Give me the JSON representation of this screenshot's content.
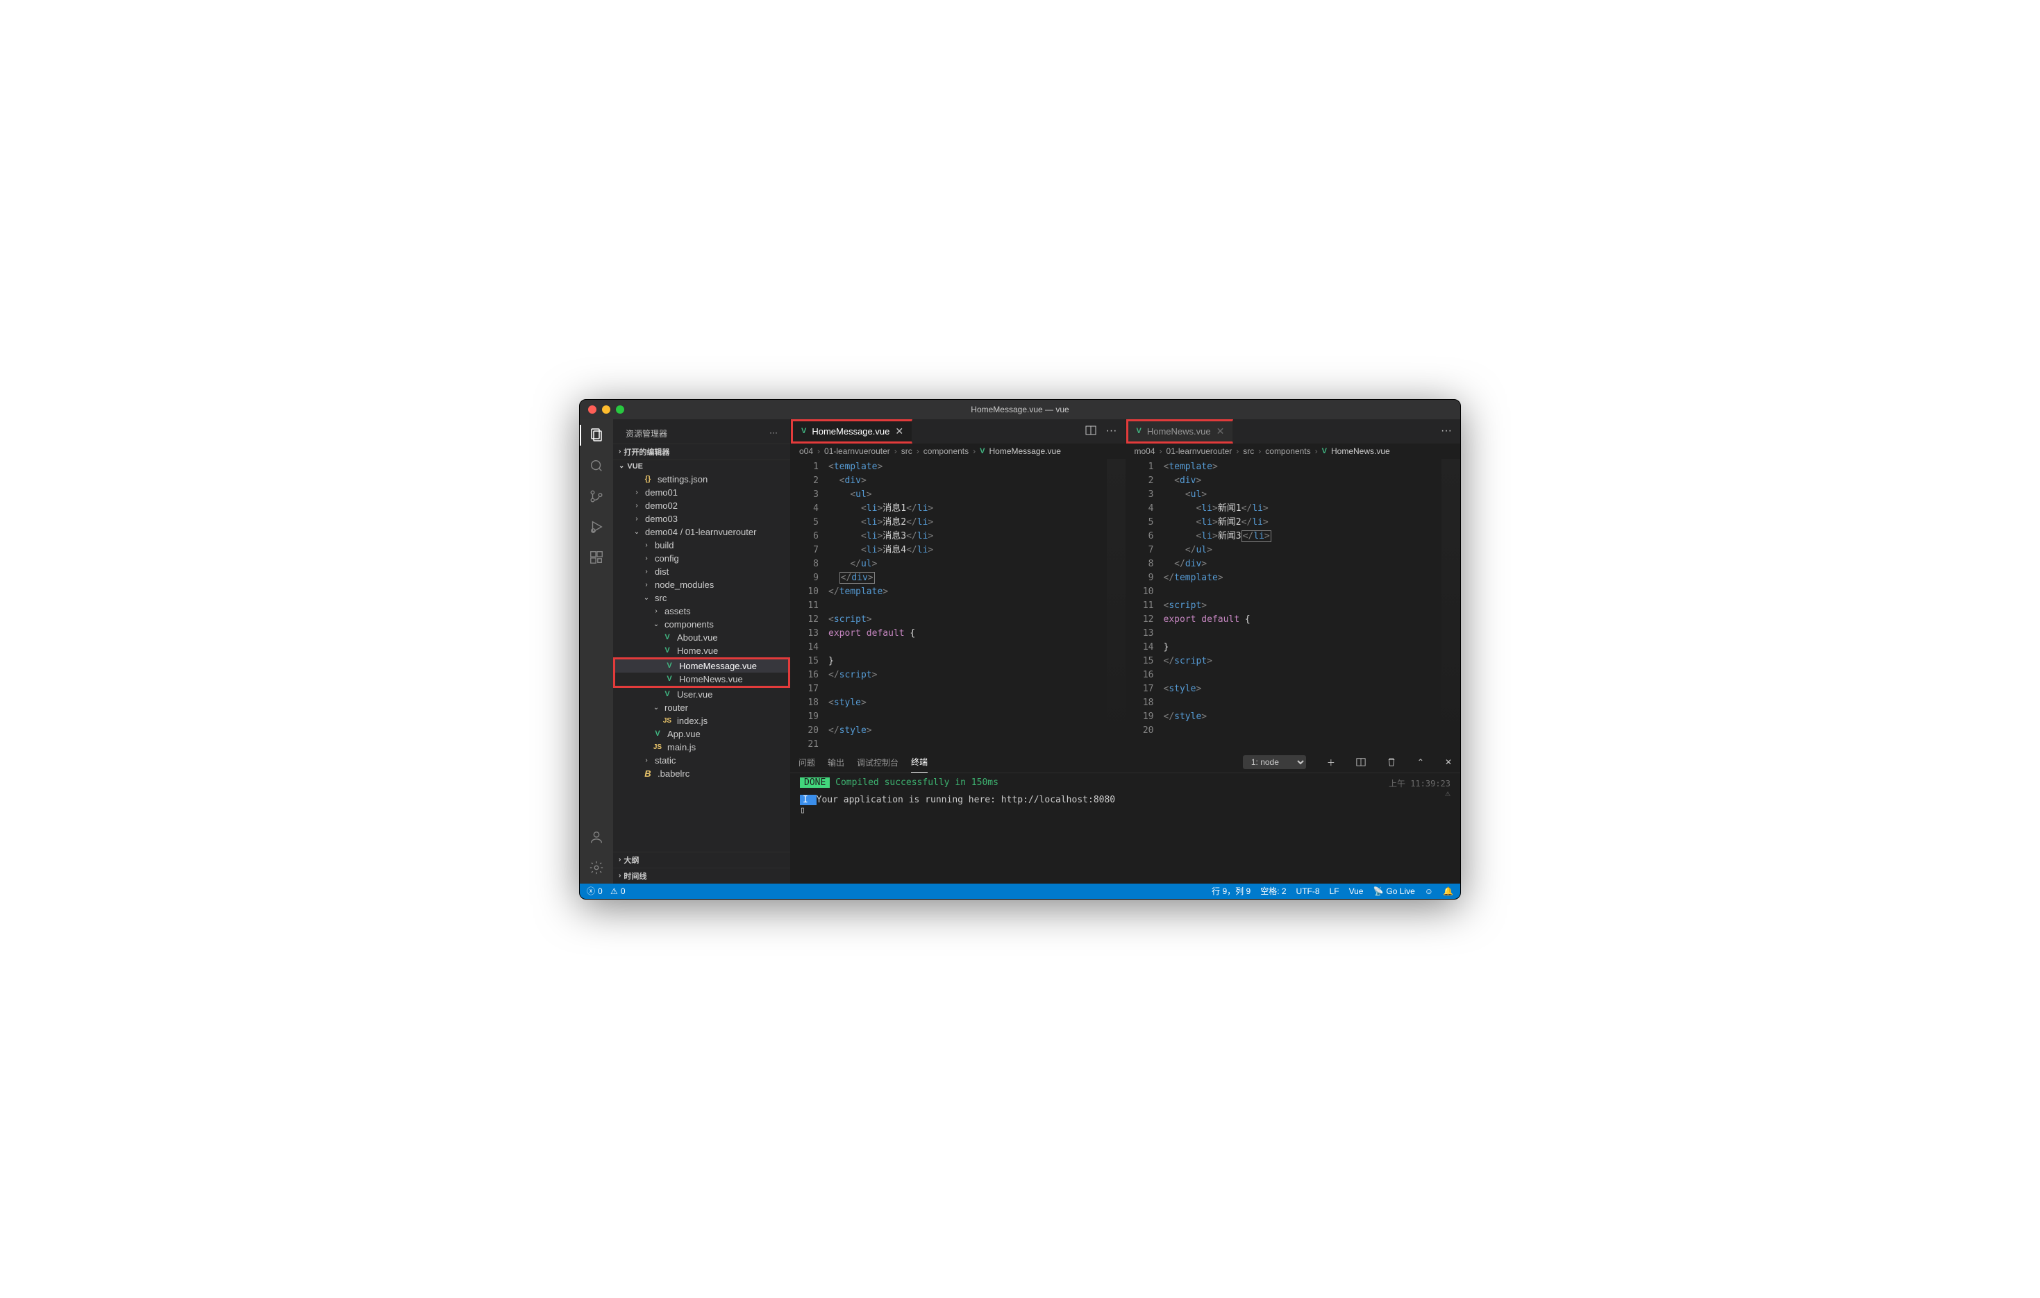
{
  "window_title": "HomeMessage.vue — vue",
  "sidebar": {
    "title": "资源管理器",
    "sections": {
      "open_editors": "打开的编辑器",
      "workspace": "VUE",
      "outline": "大纲",
      "timeline": "时间线"
    },
    "tree": {
      "settings": "settings.json",
      "demo01": "demo01",
      "demo02": "demo02",
      "demo03": "demo03",
      "demo04": "demo04 / 01-learnvuerouter",
      "build": "build",
      "config": "config",
      "dist": "dist",
      "node_modules": "node_modules",
      "src": "src",
      "assets": "assets",
      "components": "components",
      "about": "About.vue",
      "home": "Home.vue",
      "homemsg": "HomeMessage.vue",
      "homenews": "HomeNews.vue",
      "user": "User.vue",
      "router": "router",
      "indexjs": "index.js",
      "appvue": "App.vue",
      "mainjs": "main.js",
      "static": "static",
      "babelrc": ".babelrc"
    }
  },
  "editors": {
    "left": {
      "tab": "HomeMessage.vue",
      "breadcrumb": [
        "o04",
        "01-learnvuerouter",
        "src",
        "components",
        "HomeMessage.vue"
      ],
      "lines": [
        "1",
        "2",
        "3",
        "4",
        "5",
        "6",
        "7",
        "8",
        "9",
        "10",
        "11",
        "12",
        "13",
        "14",
        "15",
        "16",
        "17",
        "18",
        "19",
        "20",
        "21"
      ],
      "code": {
        "l1": "<template>",
        "l2": "  <div>",
        "l3": "    <ul>",
        "l4": "      <li>消息1</li>",
        "l5": "      <li>消息2</li>",
        "l6": "      <li>消息3</li>",
        "l7": "      <li>消息4</li>",
        "l8": "    </ul>",
        "l9": "  </div>",
        "l10": "</template>",
        "l11": "",
        "l12": "<script>",
        "l13": "export default {",
        "l14": "",
        "l15": "}",
        "l16": "</script>",
        "l17": "",
        "l18": "<style>",
        "l19": "",
        "l20": "</style>",
        "l21": ""
      }
    },
    "right": {
      "tab": "HomeNews.vue",
      "breadcrumb": [
        "mo04",
        "01-learnvuerouter",
        "src",
        "components",
        "HomeNews.vue"
      ],
      "lines": [
        "1",
        "2",
        "3",
        "4",
        "5",
        "6",
        "7",
        "8",
        "9",
        "10",
        "11",
        "12",
        "13",
        "14",
        "15",
        "16",
        "17",
        "18",
        "19",
        "20"
      ],
      "code": {
        "l1": "<template>",
        "l2": "  <div>",
        "l3": "    <ul>",
        "l4": "      <li>新闻1</li>",
        "l5": "      <li>新闻2</li>",
        "l6": "      <li>新闻3</li>",
        "l7": "    </ul>",
        "l8": "  </div>",
        "l9": "</template>",
        "l10": "",
        "l11": "<script>",
        "l12": "export default {",
        "l13": "",
        "l14": "}",
        "l15": "</script>",
        "l16": "",
        "l17": "<style>",
        "l18": "",
        "l19": "</style>",
        "l20": ""
      }
    }
  },
  "panel": {
    "tabs": {
      "problems": "问题",
      "output": "输出",
      "debug": "调试控制台",
      "terminal": "终端"
    },
    "dropdown": "1: node",
    "done": "DONE",
    "compiled": " Compiled successfully in 150ms",
    "info_prefix": " I ",
    "running": " Your application is running here: http://localhost:8080",
    "time": "上午 11:39:23"
  },
  "status": {
    "errors": "0",
    "warnings": "0",
    "position": "行 9，列 9",
    "spaces": "空格: 2",
    "encoding": "UTF-8",
    "eol": "LF",
    "lang": "Vue",
    "golive": "Go Live"
  }
}
